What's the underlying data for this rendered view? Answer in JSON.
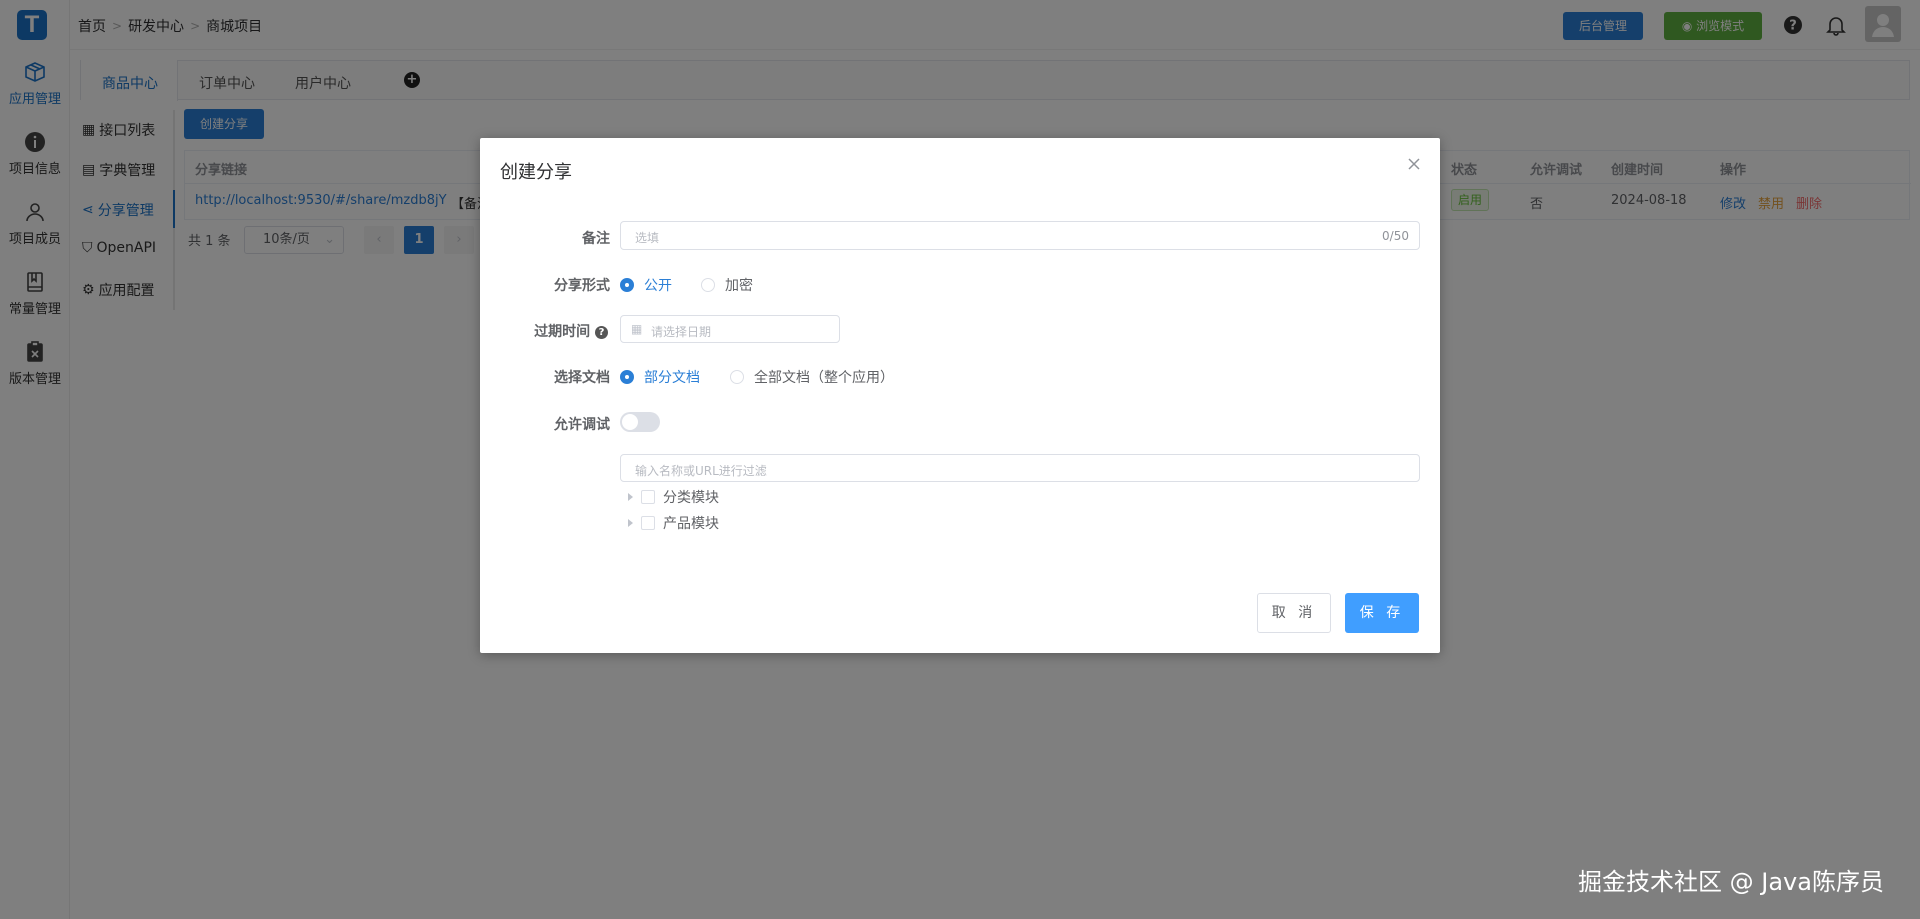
{
  "nav": {
    "logo_letter": "T",
    "items": [
      {
        "label": "应用管理",
        "icon": "box-icon",
        "active": true
      },
      {
        "label": "项目信息",
        "icon": "info-icon",
        "active": false
      },
      {
        "label": "项目成员",
        "icon": "user-icon",
        "active": false
      },
      {
        "label": "常量管理",
        "icon": "book-icon",
        "active": false
      },
      {
        "label": "版本管理",
        "icon": "clipboard-icon",
        "active": false
      }
    ]
  },
  "header": {
    "breadcrumb": [
      "首页",
      "研发中心",
      "商城项目"
    ],
    "admin_button": "后台管理",
    "browse_button": "浏览模式"
  },
  "tabs": [
    "商品中心",
    "订单中心",
    "用户中心"
  ],
  "submenu": [
    {
      "label": "接口列表",
      "icon": "grid-icon"
    },
    {
      "label": "字典管理",
      "icon": "doc-icon"
    },
    {
      "label": "分享管理",
      "icon": "share-icon"
    },
    {
      "label": "OpenAPI",
      "icon": "bookmark-icon"
    },
    {
      "label": "应用配置",
      "icon": "gear-icon"
    }
  ],
  "share_page": {
    "create_button": "创建分享",
    "columns": {
      "link": "分享链接",
      "status": "状态",
      "debug": "允许调试",
      "created": "创建时间",
      "actions": "操作"
    },
    "row": {
      "link": "http://localhost:9530/#/share/mzdb8jY",
      "note_fragment": "【备注",
      "status": "启用",
      "debug": "否",
      "created": "2024-08-18",
      "action_edit": "修改",
      "action_disable": "禁用",
      "action_delete": "删除"
    },
    "pager": {
      "total": "共 1 条",
      "page_size": "10条/页",
      "current": "1"
    }
  },
  "dialog": {
    "title": "创建分享",
    "note_label": "备注",
    "note_placeholder": "选填",
    "note_counter": "0/50",
    "share_type_label": "分享形式",
    "share_public": "公开",
    "share_encrypted": "加密",
    "expire_label": "过期时间",
    "expire_placeholder": "请选择日期",
    "doc_label": "选择文档",
    "doc_partial": "部分文档",
    "doc_all": "全部文档（整个应用）",
    "debug_label": "允许调试",
    "filter_placeholder": "输入名称或URL进行过滤",
    "tree": [
      "分类模块",
      "产品模块"
    ],
    "cancel": "取 消",
    "save": "保 存"
  },
  "watermark": "掘金技术社区 @ Java陈序员",
  "colors": {
    "primary": "#2b7fd6",
    "success": "#5fb140",
    "warning": "#e6a23c",
    "danger": "#f56c6c"
  }
}
